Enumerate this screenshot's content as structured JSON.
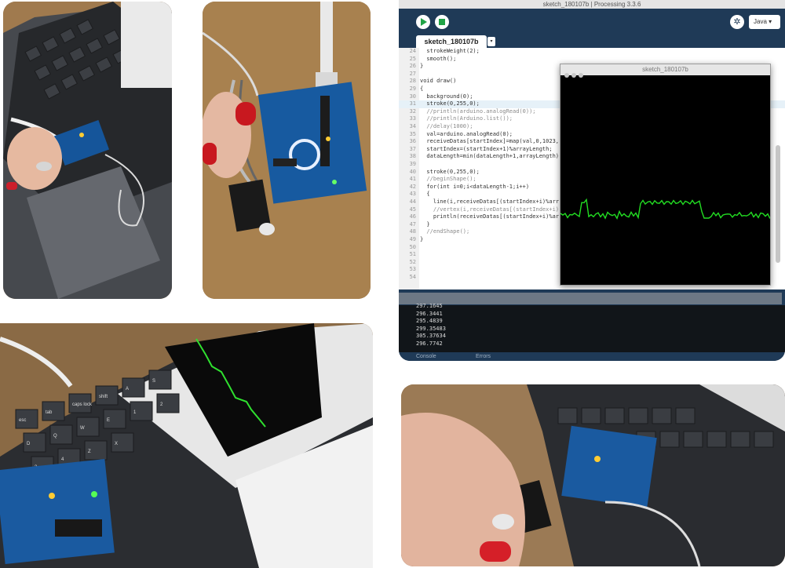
{
  "ide": {
    "window_title": "sketch_180107b | Processing 3.3.6",
    "mode": "Java",
    "mode_arrow": "▾",
    "debug_icon": "✲",
    "tab_label": "sketch_180107b",
    "tab_arrow": "▾",
    "code_lines": [
      {
        "n": "24",
        "t": "  strokeWeight(2);"
      },
      {
        "n": "25",
        "t": "  smooth();"
      },
      {
        "n": "26",
        "t": "}"
      },
      {
        "n": "27",
        "t": ""
      },
      {
        "n": "28",
        "t": "void draw()"
      },
      {
        "n": "29",
        "t": "{"
      },
      {
        "n": "30",
        "t": "  background(0);"
      },
      {
        "n": "31",
        "t": "  stroke(0,255,0);"
      },
      {
        "n": "32",
        "t": "  //println(arduino.analogRead(0));"
      },
      {
        "n": "33",
        "t": "  //println(Arduino.list());"
      },
      {
        "n": "34",
        "t": "  //delay(1000);"
      },
      {
        "n": "35",
        "t": "  val=arduino.analogRead(0);"
      },
      {
        "n": "36",
        "t": "  receiveDatas[startIndex]=map(val,0,1023,"
      },
      {
        "n": "37",
        "t": "  startIndex=(startIndex+1)%arrayLength;"
      },
      {
        "n": "38",
        "t": "  dataLength=min(dataLength+1,arrayLength)"
      },
      {
        "n": "39",
        "t": ""
      },
      {
        "n": "40",
        "t": "  stroke(0,255,0);"
      },
      {
        "n": "41",
        "t": "  //beginShape();"
      },
      {
        "n": "42",
        "t": "  for(int i=0;i<dataLength-1;i++)"
      },
      {
        "n": "43",
        "t": "  {"
      },
      {
        "n": "44",
        "t": "    line(i,receiveDatas[(startIndex+i)%arr"
      },
      {
        "n": "45",
        "t": "    //vertex(i,receiveDatas[(startIndex+i)"
      },
      {
        "n": "46",
        "t": "    println(receiveDatas[(startIndex+i)%ar"
      },
      {
        "n": "47",
        "t": "  }"
      },
      {
        "n": "48",
        "t": "  //endShape();"
      },
      {
        "n": "49",
        "t": "}"
      },
      {
        "n": "50",
        "t": ""
      },
      {
        "n": "51",
        "t": ""
      },
      {
        "n": "52",
        "t": ""
      },
      {
        "n": "53",
        "t": ""
      },
      {
        "n": "54",
        "t": ""
      }
    ],
    "sketch_window_title": "sketch_180107b",
    "console_lines": [
      "297.1645",
      "296.3441",
      "295.4839",
      "299.35483",
      "305.37634",
      "296.7742"
    ],
    "console_tab": "Console",
    "errors_tab": "Errors",
    "signal_color": "#22dd22"
  },
  "photos": {
    "keyboard_keys": [
      "esc",
      "tab",
      "caps lock",
      "shift",
      "A",
      "S",
      "D",
      "Q",
      "W",
      "E",
      "1",
      "2",
      "3",
      "4",
      "Z",
      "X"
    ]
  }
}
